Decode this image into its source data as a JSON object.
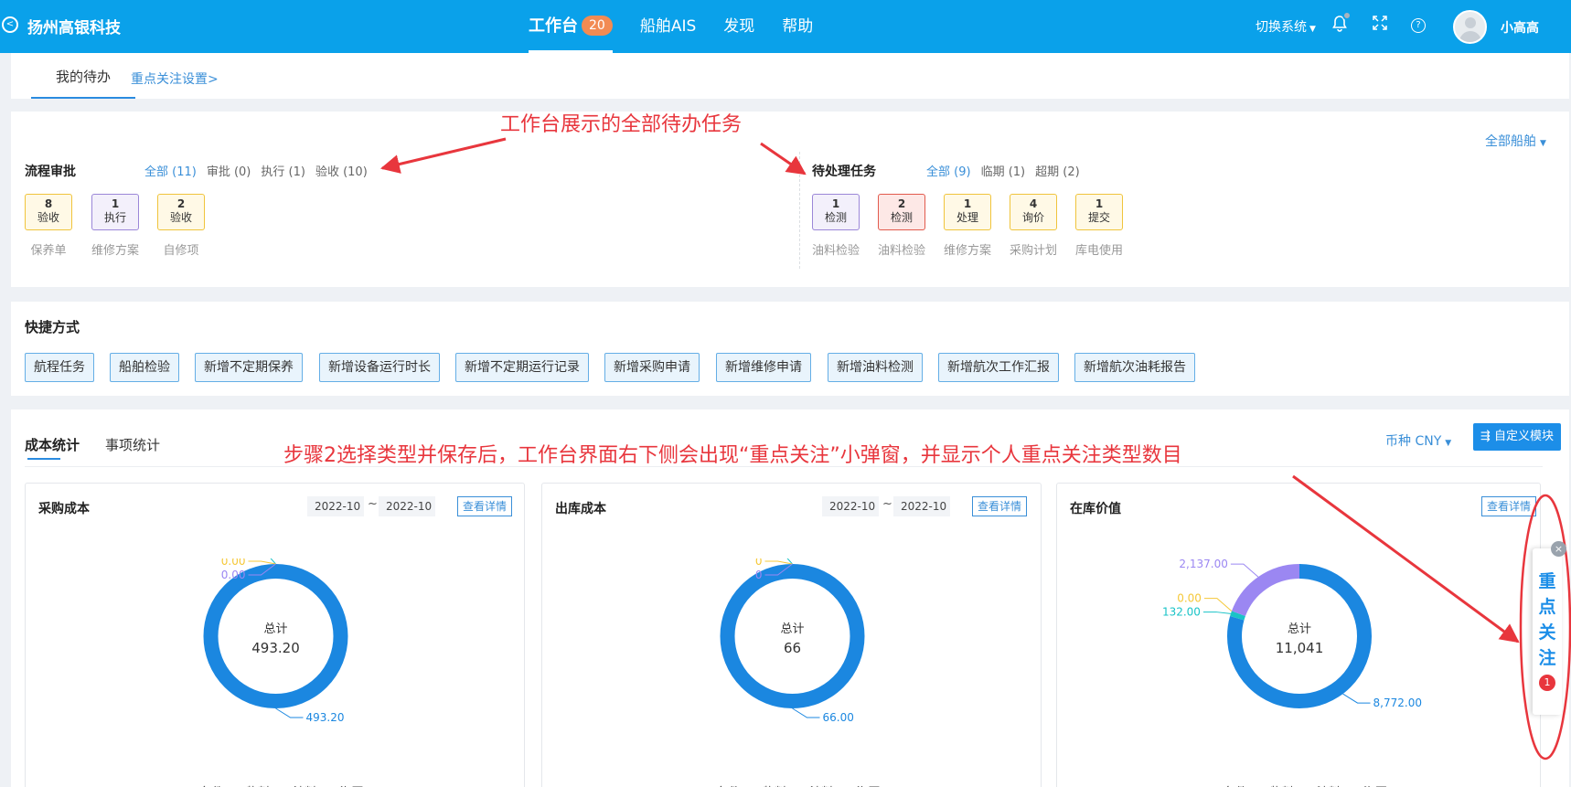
{
  "header": {
    "brand": "扬州高银科技",
    "nav": [
      {
        "label": "工作台",
        "badge": "20"
      },
      {
        "label": "船舶AIS"
      },
      {
        "label": "发现"
      },
      {
        "label": "帮助"
      }
    ],
    "switch_system": "切换系统",
    "username": "小高高"
  },
  "tabs": {
    "mine": "我的待办",
    "focus_settings": "重点关注设置>"
  },
  "approval": {
    "title": "流程审批",
    "filters": [
      "全部 (11)",
      "审批 (0)",
      "执行 (1)",
      "验收 (10)"
    ],
    "tasks": [
      {
        "count": "8",
        "type": "验收",
        "label": "保养单",
        "color": "yellow"
      },
      {
        "count": "1",
        "type": "执行",
        "label": "维修方案",
        "color": "purple"
      },
      {
        "count": "2",
        "type": "验收",
        "label": "自修项",
        "color": "yellow"
      }
    ]
  },
  "pending": {
    "title": "待处理任务",
    "filters": [
      "全部 (9)",
      "临期 (1)",
      "超期 (2)"
    ],
    "all_ships": "全部船舶",
    "tasks": [
      {
        "count": "1",
        "type": "检测",
        "label": "油料检验",
        "color": "purple"
      },
      {
        "count": "2",
        "type": "检测",
        "label": "油料检验",
        "color": "red"
      },
      {
        "count": "1",
        "type": "处理",
        "label": "维修方案",
        "color": "yellow"
      },
      {
        "count": "4",
        "type": "询价",
        "label": "采购计划",
        "color": "yellow"
      },
      {
        "count": "1",
        "type": "提交",
        "label": "库电使用",
        "color": "yellow"
      }
    ]
  },
  "quick": {
    "title": "快捷方式",
    "buttons": [
      "航程任务",
      "船舶检验",
      "新增不定期保养",
      "新增设备运行时长",
      "新增不定期运行记录",
      "新增采购申请",
      "新增维修申请",
      "新增油料检测",
      "新增航次工作汇报",
      "新增航次油耗报告"
    ]
  },
  "stats": {
    "tabs": [
      "成本统计",
      "事项统计"
    ],
    "currency": "币种  CNY",
    "custom_module": "自定义模块",
    "cards": [
      {
        "title": "采购成本",
        "date_from": "2022-10",
        "date_to": "2022-10",
        "detail": "查看详情",
        "total_label": "总计",
        "total": "493.20",
        "values": [
          493.2,
          0,
          0,
          0
        ],
        "value_labels": [
          "493.20",
          "0.00",
          "0.00",
          "0.00"
        ]
      },
      {
        "title": "出库成本",
        "date_from": "2022-10",
        "date_to": "2022-10",
        "detail": "查看详情",
        "total_label": "总计",
        "total": "66",
        "values": [
          66,
          0,
          0,
          0
        ],
        "value_labels": [
          "66.00",
          "0",
          "0",
          "0"
        ]
      },
      {
        "title": "在库价值",
        "detail": "查看详情",
        "total_label": "总计",
        "total": "11,041",
        "values": [
          8772,
          132,
          0,
          2137
        ],
        "value_labels": [
          "8,772.00",
          "132.00",
          "0.00",
          "2,137.00"
        ]
      }
    ],
    "legend": [
      "备件",
      "物料",
      "油料",
      "海图"
    ],
    "legend_colors": [
      "#1b87e0",
      "#19c3c7",
      "#f5c838",
      "#9b87f2"
    ]
  },
  "annotations": {
    "a1": "工作台展示的全部待办任务",
    "a2": "步骤2选择类型并保存后，工作台界面右下侧会出现“重点关注”小弹窗，并显示个人重点关注类型数目",
    "color": "#e8363d"
  },
  "focus_popup": {
    "label": "重点关注",
    "count": "1"
  }
}
